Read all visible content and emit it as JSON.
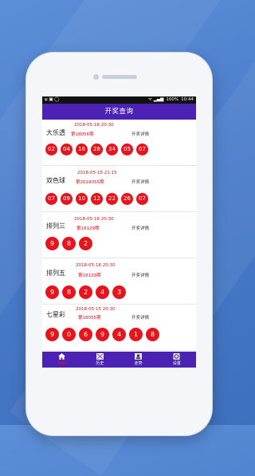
{
  "status": {
    "left_icons": "ψ ▣ ◯",
    "signal": "ᯤ ▂▄▆",
    "battery": "100%",
    "time": "10:44"
  },
  "header": {
    "title": "开奖查询"
  },
  "colors": {
    "accent": "#4b22b3",
    "ball": "#e8141d",
    "date": "#dd1111"
  },
  "lotteries": [
    {
      "name": "大乐透",
      "date": "2018-05-16 20:30",
      "issue": "第18056期",
      "detail": "开奖详情",
      "numbers": [
        "02",
        "04",
        "16",
        "28",
        "34",
        "05",
        "07"
      ]
    },
    {
      "name": "双色球",
      "date": "2018-05-15 21:15",
      "issue": "第2018055期",
      "detail": "开奖详情",
      "numbers": [
        "07",
        "09",
        "10",
        "12",
        "22",
        "26",
        "07"
      ]
    },
    {
      "name": "排列三",
      "date": "2018-05-16 20:30",
      "issue": "第18129期",
      "detail": "开奖详情",
      "numbers": [
        "9",
        "8",
        "2"
      ]
    },
    {
      "name": "排列五",
      "date": "2018-05-16 20:30",
      "issue": "第18129期",
      "detail": "开奖详情",
      "numbers": [
        "9",
        "8",
        "2",
        "4",
        "3"
      ]
    },
    {
      "name": "七星彩",
      "date": "2018-05-15 20:30",
      "issue": "第18055期",
      "detail": "开奖详情",
      "numbers": [
        "9",
        "0",
        "6",
        "9",
        "4",
        "1",
        "8"
      ]
    }
  ],
  "tabs": [
    {
      "label": "首页",
      "icon": "home-icon"
    },
    {
      "label": "历史",
      "icon": "history-icon"
    },
    {
      "label": "走势",
      "icon": "trend-icon"
    },
    {
      "label": "设置",
      "icon": "settings-icon"
    }
  ]
}
